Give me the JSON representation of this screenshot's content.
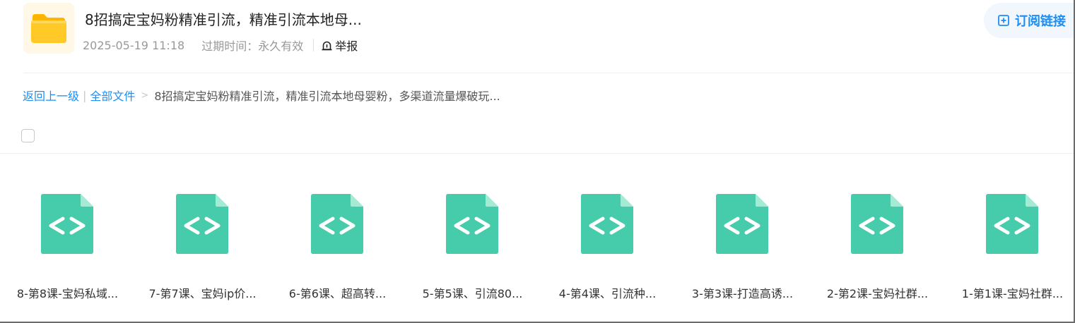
{
  "header": {
    "title": "8招搞定宝妈粉精准引流，精准引流本地母...",
    "date": "2025-05-19 11:18",
    "expire_text": "过期时间：永久有效",
    "report_label": "举报",
    "subscribe_label": "订阅链接"
  },
  "breadcrumb": {
    "back_label": "返回上一级",
    "all_files_label": "全部文件",
    "separator": "|",
    "arrow": ">",
    "current": "8招搞定宝妈粉精准引流，精准引流本地母婴粉，多渠道流量爆破玩..."
  },
  "files": [
    {
      "name": "8-第8课-宝妈私域..."
    },
    {
      "name": "7-第7课、宝妈ip价..."
    },
    {
      "name": "6-第6课、超高转..."
    },
    {
      "name": "5-第5课、引流80..."
    },
    {
      "name": "4-第4课、引流种..."
    },
    {
      "name": "3-第3课-打造高诱..."
    },
    {
      "name": "2-第2课-宝妈社群..."
    },
    {
      "name": "1-第1课-宝妈社群..."
    }
  ],
  "icons": {
    "folder": "folder-icon",
    "file": "code-file-icon",
    "report": "alarm-icon",
    "subscribe": "subscribe-icon"
  },
  "colors": {
    "accent": "#1d8ef5",
    "file_icon": "#46ccab",
    "file_fold": "#a4ebd6",
    "folder": "#ffc226"
  }
}
